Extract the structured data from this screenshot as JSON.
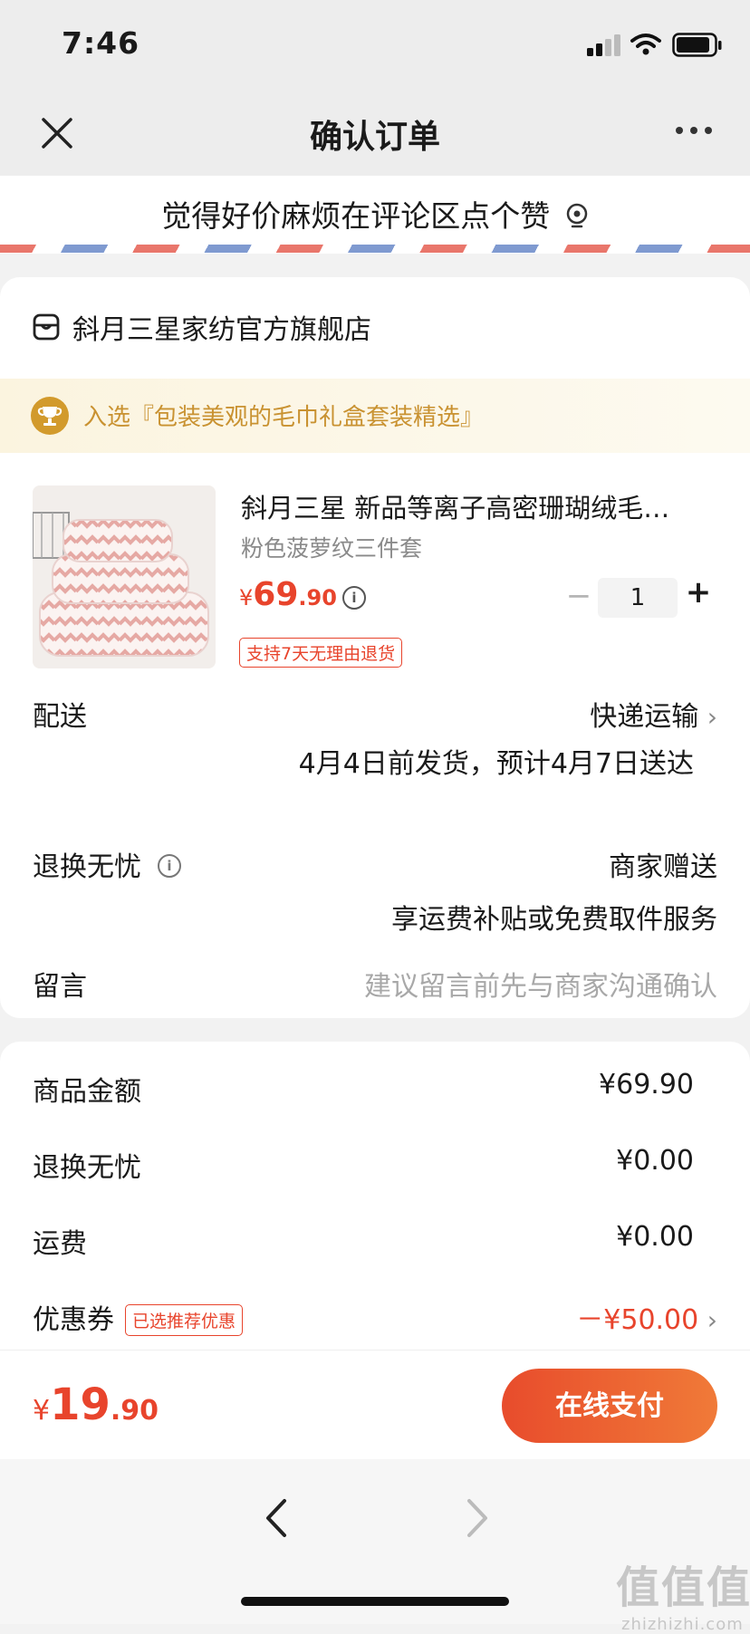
{
  "status_bar": {
    "time": "7:46"
  },
  "nav": {
    "title": "确认订单",
    "close_icon": "close-icon",
    "more_icon": "more-icon"
  },
  "promo": {
    "text": "觉得好价麻烦在评论区点个赞"
  },
  "store": {
    "name": "斜月三星家纺官方旗舰店"
  },
  "banner": {
    "text": "入选『包装美观的毛巾礼盒套装精选』"
  },
  "product": {
    "title": "斜月三星 新品等离子高密珊瑚绒毛…",
    "variant": "粉色菠萝纹三件套",
    "price_symbol": "¥",
    "price_int": "69",
    "price_dec": ".90",
    "quantity": "1",
    "return_tag": "支持7天无理由退货"
  },
  "delivery": {
    "label": "配送",
    "method": "快递运输",
    "estimate": "4月4日前发货，预计4月7日送达"
  },
  "return_worry_free": {
    "label": "退换无忧",
    "value": "商家赠送",
    "detail": "享运费补贴或免费取件服务"
  },
  "message": {
    "label": "留言",
    "placeholder": "建议留言前先与商家沟通确认"
  },
  "summary": {
    "rows": [
      {
        "label": "商品金额",
        "value": "¥69.90"
      },
      {
        "label": "退换无忧",
        "value": "¥0.00"
      },
      {
        "label": "运费",
        "value": "¥0.00"
      }
    ],
    "coupon": {
      "label": "优惠券",
      "tag": "已选推荐优惠",
      "value": "－¥50.00"
    }
  },
  "footer": {
    "total_symbol": "¥",
    "total_int": "19",
    "total_dec": ".90",
    "pay_label": "在线支付"
  },
  "watermark": {
    "brand": "值值值",
    "domain": "zhizhizhi.com"
  },
  "colors": {
    "accent": "#e8442c",
    "gold": "#c99231",
    "background": "#f2f2f2"
  }
}
